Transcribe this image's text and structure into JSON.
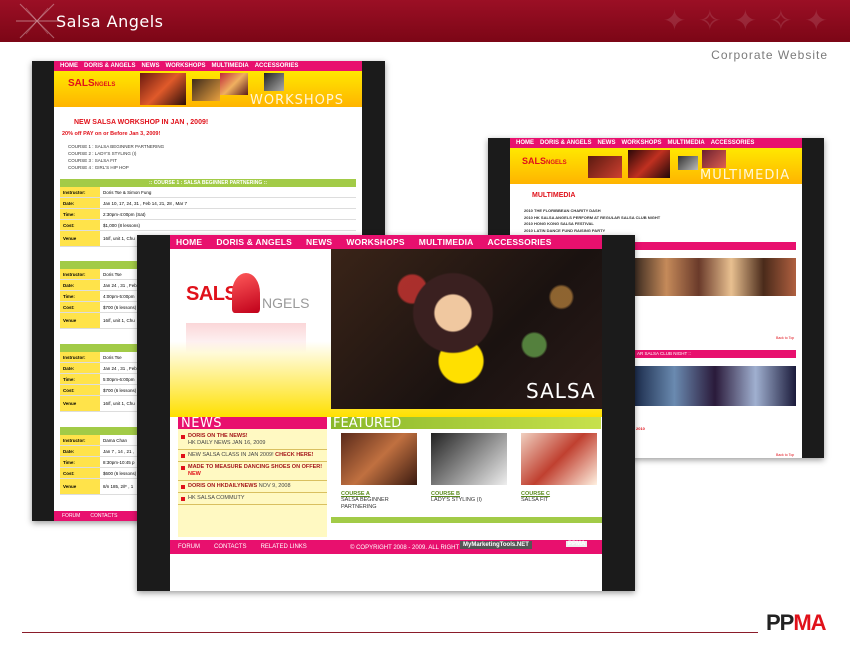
{
  "header": {
    "title": "Salsa Angels",
    "subtitle": "Corporate Website"
  },
  "colors": {
    "brand_red": "#7c0616",
    "hot_pink": "#e8106e",
    "yellow": "#ffd500",
    "green": "#8ab82a"
  },
  "nav": [
    "HOME",
    "DORIS & ANGELS",
    "NEWS",
    "WORKSHOPS",
    "MULTIMEDIA",
    "ACCESSORIES"
  ],
  "workshops": {
    "page_word": "WORKSHOPS",
    "headline": "NEW SALSA WORKSHOP IN JAN , 2009!",
    "offer": "20% off PAY on or Before Jan 3, 2009!",
    "courses": [
      "COURSE 1 : SALSA BEGINNER PARTNERING",
      "COURSE 2 : LADY'S STYLING (I)",
      "COURSE 3 : SALSA FIT",
      "COURSE 4 : GIRL'S HIP HOP"
    ],
    "table_title": ":: COURSE 1 : SALSA BEGINNER PARTNERING ::",
    "rows": [
      {
        "label": "Instructor:",
        "value": "Doris Tse & Simon Fung"
      },
      {
        "label": "Date:",
        "value": "Jan 10, 17, 24, 31 , Feb 14, 21, 28 , Mar 7"
      },
      {
        "label": "Time:",
        "value": "2:30pm-4:00pm (Sat)"
      },
      {
        "label": "Cost:",
        "value": "$1,000 (8 lessons)"
      },
      {
        "label": "Venue",
        "value": "16/f, unit 1, Chu"
      }
    ],
    "block2": [
      {
        "label": "Instructor:",
        "value": "Doris Tse"
      },
      {
        "label": "Date:",
        "value": "Jan 24 , 31 , Feb"
      },
      {
        "label": "Time:",
        "value": "4:00pm-5:00pm"
      },
      {
        "label": "Cost:",
        "value": "$700 (6 lessons)"
      },
      {
        "label": "Venue",
        "value": "16/f, unit 1, Chu"
      }
    ],
    "block3": [
      {
        "label": "Instructor:",
        "value": "Doris Tse"
      },
      {
        "label": "Date:",
        "value": "Jan 24 , 31 , Feb"
      },
      {
        "label": "Time:",
        "value": "5:00pm-6:00pm"
      },
      {
        "label": "Cost:",
        "value": "$700 (6 lessons)"
      },
      {
        "label": "Venue",
        "value": "16/f, unit 1, Chu"
      }
    ],
    "block4": [
      {
        "label": "Instructor:",
        "value": "Dama Chan"
      },
      {
        "label": "Date:",
        "value": "Jan 7 , 14 , 21 ,"
      },
      {
        "label": "Time:",
        "value": "8:30pm-10:45 p"
      },
      {
        "label": "Cost:",
        "value": "$600 (6 lessons)"
      },
      {
        "label": "Venue",
        "value": "8/n 185, 2/F , 1"
      }
    ],
    "footer": [
      "FORUM",
      "CONTACTS"
    ]
  },
  "multimedia": {
    "page_word": "MULTIMEDIA",
    "section": "MULTIMEDIA",
    "items": [
      "2010 THE FLORIBBEAN CHARITY DASH",
      "2010 HK SALSA ANGELS PERFORM AT REGULAR SALSA CLUB NIGHT",
      "2010 HONG KONG SALSA FESTIVAL",
      "2010 LATIN DANCE FUND RAISING PARTY"
    ],
    "bar2": "AR SALSA CLUB NIGHT ::",
    "back": "Back to Top",
    "year": "2010"
  },
  "main": {
    "logo_left": "SALS",
    "logo_right": "NGELS",
    "hero_word": "SALSA",
    "news_title": "NEWS",
    "featured_title": "FEATURED",
    "news": [
      {
        "bold": "DORIS ON THE NEWS!",
        "text": "HK DAILY NEWS JAN 16, 2009",
        "link": ""
      },
      {
        "bold": "",
        "text": "NEW SALSA CLASS IN JAN 2009!",
        "link": "CHECK HERE!"
      },
      {
        "bold": "MADE TO MEASURE DANCING SHOES ON OFFER!",
        "text": "",
        "link": "NEW"
      },
      {
        "bold": "DORIS ON HKDAILYNEWS",
        "text": "NOV 9, 2008",
        "link": ""
      },
      {
        "bold": "",
        "text": "HK SALSA COMMUTY",
        "link": ""
      }
    ],
    "courses": [
      {
        "link": "COURSE A",
        "desc": "SALSA BEGINNER PARTNERING"
      },
      {
        "link": "COURSE B",
        "desc": "LADY'S STYLING (I)"
      },
      {
        "link": "COURSE C",
        "desc": "SALSA FIT"
      }
    ],
    "footer_links": [
      "FORUM",
      "CONTACTS",
      "RELATED LINKS"
    ],
    "copyright": "© COPYRIGHT 2008 - 2009. ALL RIGHT RESERVED",
    "brand_mmt": "MyMarketingTools.NET",
    "brand_ppma": "PPMA"
  },
  "footer_logo": {
    "left": "PP",
    "right": "MA"
  }
}
